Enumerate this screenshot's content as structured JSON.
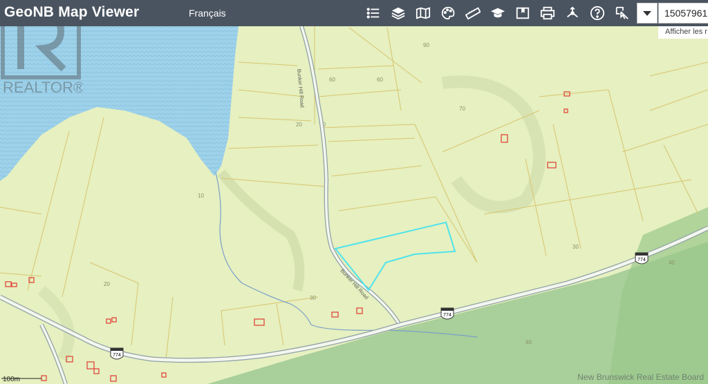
{
  "app": {
    "title": "GeoNB Map Viewer",
    "language_link": "Français"
  },
  "toolbar": {
    "tools": [
      {
        "name": "legend-list-icon"
      },
      {
        "name": "layers-icon"
      },
      {
        "name": "basemap-icon"
      },
      {
        "name": "palette-icon"
      },
      {
        "name": "measure-ruler-icon"
      },
      {
        "name": "education-cap-icon"
      },
      {
        "name": "bookmark-icon"
      },
      {
        "name": "print-icon"
      },
      {
        "name": "share-icon"
      },
      {
        "name": "help-icon"
      },
      {
        "name": "identify-icon"
      }
    ]
  },
  "search": {
    "value": "15057961",
    "hint": "Afficher les r"
  },
  "map": {
    "road_label": "Bunker Hill Road",
    "route_shield": "774",
    "contours": [
      "90",
      "60",
      "60",
      "20",
      "20",
      "70",
      "10",
      "20",
      "30",
      "30",
      "40",
      "40"
    ],
    "scale": "100m",
    "credit": "New Brunswick Real Estate Board",
    "watermark_text": "REALTOR®",
    "colors": {
      "land": "#e6f0c0",
      "water": "#9ed2ea",
      "forest": "#a9cf9a",
      "parcel_line": "#d8c470",
      "highlight": "#4fe3ec",
      "building": "#e0463c",
      "toolbar": "#4a5460"
    }
  }
}
